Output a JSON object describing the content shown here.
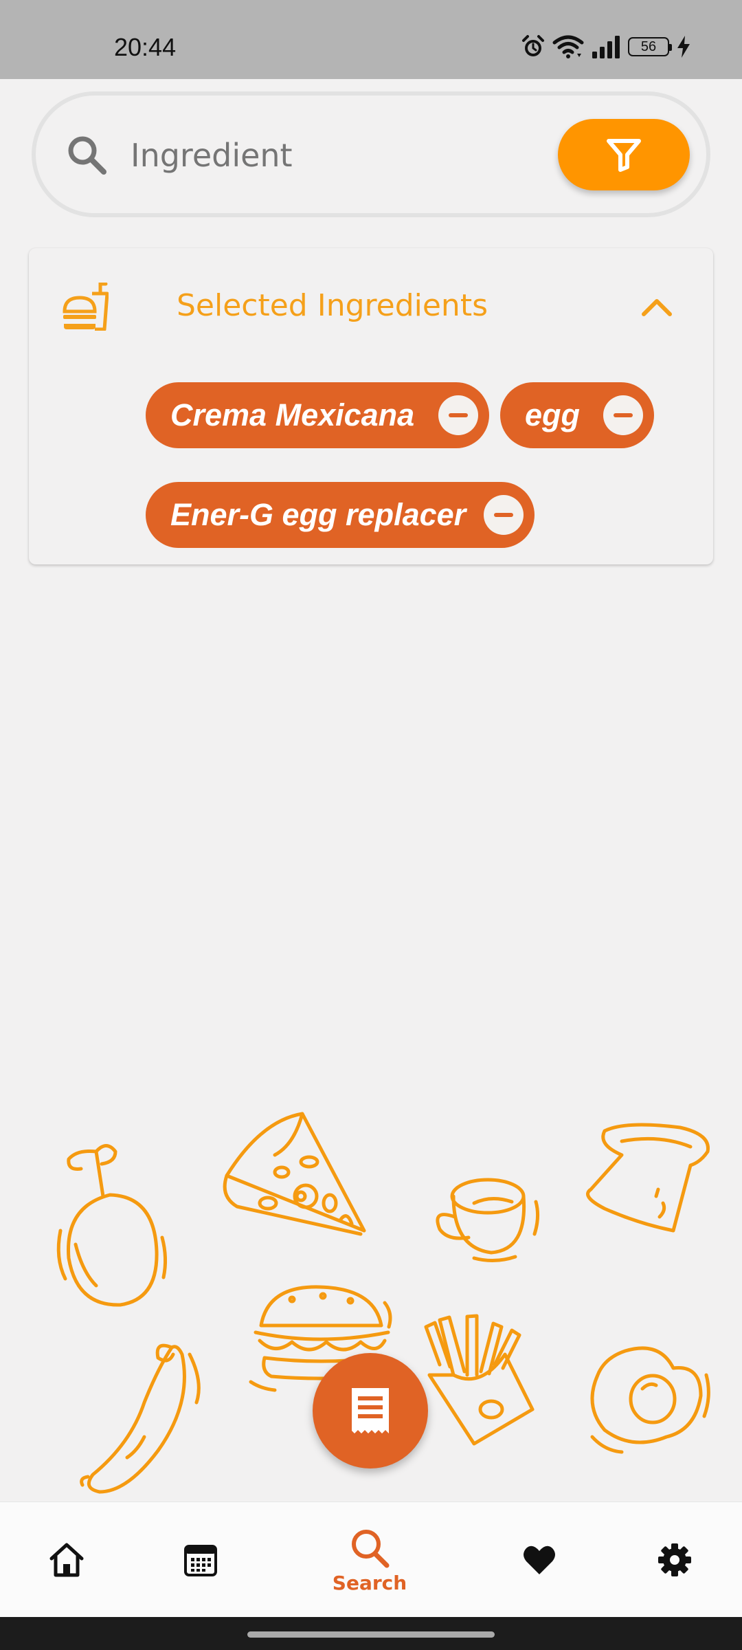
{
  "status_bar": {
    "time": "20:44",
    "battery_level": "56",
    "icons": [
      "alarm-icon",
      "wifi-icon",
      "signal-icon",
      "battery-icon",
      "charging-icon"
    ]
  },
  "search": {
    "placeholder": "Ingredient",
    "value": "",
    "icon": "search-icon",
    "filter_icon": "filter-icon"
  },
  "selected_ingredients": {
    "title": "Selected Ingredients",
    "icon": "fast-food-icon",
    "expanded": true,
    "items": [
      {
        "label": "Crema Mexicana"
      },
      {
        "label": "egg"
      },
      {
        "label": "Ener-G egg replacer"
      }
    ]
  },
  "fab": {
    "icon": "receipt-icon"
  },
  "bottom_nav": {
    "items": [
      {
        "icon": "home-icon",
        "label": ""
      },
      {
        "icon": "calendar-icon",
        "label": ""
      },
      {
        "icon": "search-icon",
        "label": "Search",
        "active": true
      },
      {
        "icon": "heart-icon",
        "label": ""
      },
      {
        "icon": "settings-icon",
        "label": ""
      }
    ]
  },
  "colors": {
    "accent": "#e06325",
    "filter_button": "#ff9500",
    "title": "#f5a01a",
    "background": "#f2f1f1",
    "doodle": "#f59a10"
  }
}
